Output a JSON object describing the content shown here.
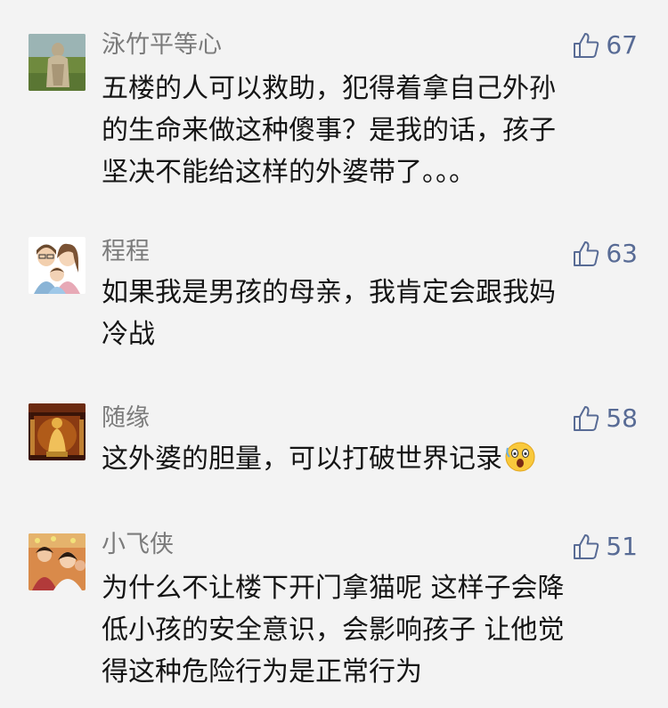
{
  "comments": [
    {
      "name": "泳竹平等心",
      "likes": "67",
      "avatar_icon": "statue-photo-avatar",
      "lines": [
        "五楼的人可以救助，犯得着拿自己外孙",
        "的生命来做这种傻事？是我的话，孩子",
        "坚决不能给这样的外婆带了。。。"
      ]
    },
    {
      "name": "程程",
      "likes": "63",
      "avatar_icon": "cartoon-family-avatar",
      "lines": [
        "如果我是男孩的母亲，我肯定会跟我妈",
        "冷战"
      ]
    },
    {
      "name": "随缘",
      "likes": "58",
      "avatar_icon": "buddha-shrine-avatar",
      "lines": [
        "这外婆的胆量，可以打破世界记录"
      ],
      "emoji": "shocked-face-emoji"
    },
    {
      "name": "小飞侠",
      "likes": "51",
      "avatar_icon": "group-photo-avatar",
      "lines": [
        "为什么不让楼下开门拿猫呢 这样子会降",
        "低小孩的安全意识，会影响孩子 让他觉",
        "得这种危险行为是正常行为"
      ]
    }
  ],
  "colors": {
    "background": "#f3f3f3",
    "name": "#7b7b7b",
    "like": "#586b95",
    "text": "#151515"
  }
}
